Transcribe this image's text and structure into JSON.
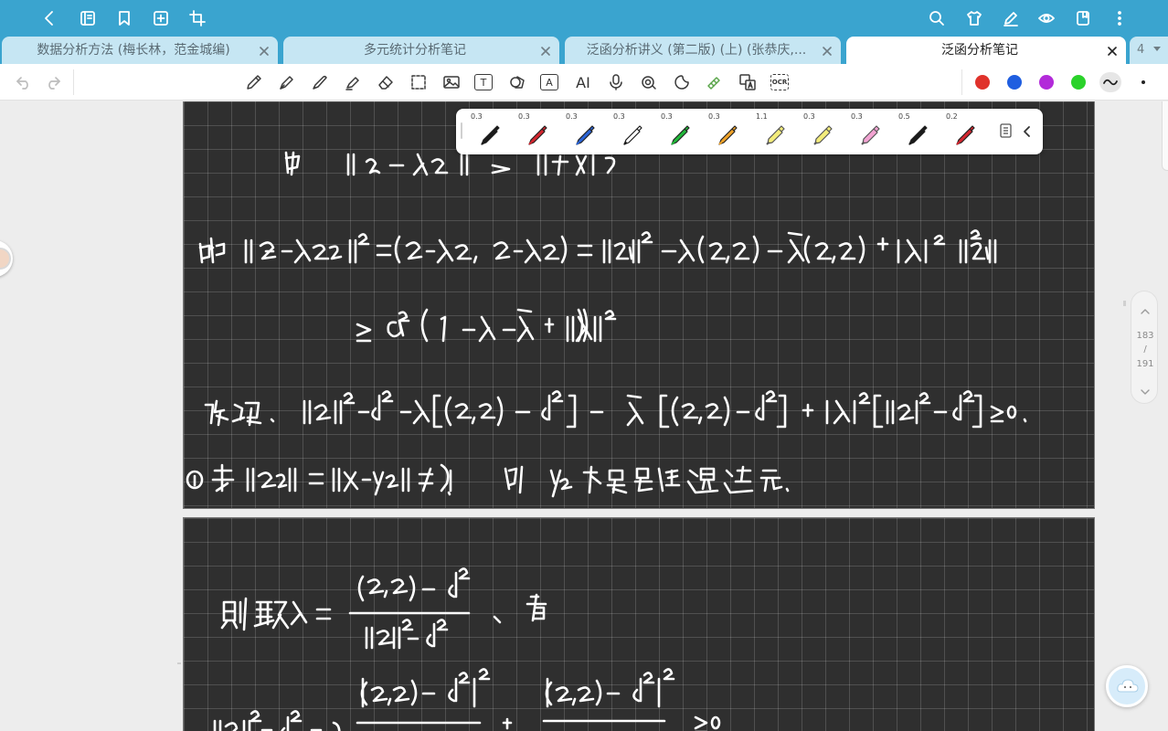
{
  "topbar": {
    "icons": [
      "back-icon",
      "notebook-icon",
      "bookmark-icon",
      "add-page-icon",
      "crop-icon",
      "search-icon",
      "theme-shirt-icon",
      "edit-pen-icon",
      "eye-icon",
      "note-tab-icon",
      "more-vert-icon"
    ]
  },
  "tabs": [
    {
      "label": "数据分析方法 (梅长林，范金城编)",
      "active": false
    },
    {
      "label": "多元统计分析笔记",
      "active": false
    },
    {
      "label": "泛函分析讲义 (第二版) (上) (张恭庆,...",
      "active": false
    },
    {
      "label": "泛函分析笔记",
      "active": true
    }
  ],
  "tab_count": "4",
  "toolbar": {
    "tools": [
      "pencil-icon",
      "fountain-pen-icon",
      "pen-icon",
      "highlighter-icon",
      "eraser-icon",
      "lasso-select-icon",
      "image-icon",
      "text-box-icon",
      "shapes-icon",
      "text-recognition-icon",
      "ai-icon",
      "microphone-icon",
      "audio-note-icon",
      "sticker-icon",
      "laser-pointer-icon",
      "translate-icon",
      "ocr-icon"
    ],
    "ai_label": "AI",
    "text_label": "T",
    "ocr_label": "OCR",
    "colors": [
      "#e0322b",
      "#1f5ee0",
      "#b22ad9",
      "#2ad22a"
    ]
  },
  "pen_picker": {
    "pens": [
      {
        "size": "0.3",
        "color": "#1a1a1a",
        "kind": "marker"
      },
      {
        "size": "0.3",
        "color": "#d3262f",
        "kind": "marker"
      },
      {
        "size": "0.3",
        "color": "#2b64d6",
        "kind": "marker"
      },
      {
        "size": "0.3",
        "color": "#1a1a1a",
        "kind": "outline"
      },
      {
        "size": "0.3",
        "color": "#21b83a",
        "kind": "marker"
      },
      {
        "size": "0.3",
        "color": "#f0a32a",
        "kind": "marker"
      },
      {
        "size": "1.1",
        "color": "#f3ec7a",
        "kind": "highlighter"
      },
      {
        "size": "0.3",
        "color": "#f3ec7a",
        "kind": "highlighter"
      },
      {
        "size": "0.3",
        "color": "#f2a3d2",
        "kind": "highlighter"
      },
      {
        "size": "0.5",
        "color": "#1a1a1a",
        "kind": "marker"
      },
      {
        "size": "0.2",
        "color": "#d3262f",
        "kind": "marker"
      }
    ]
  },
  "page_indicator": {
    "current": "183",
    "separator": "/",
    "total": "191"
  }
}
